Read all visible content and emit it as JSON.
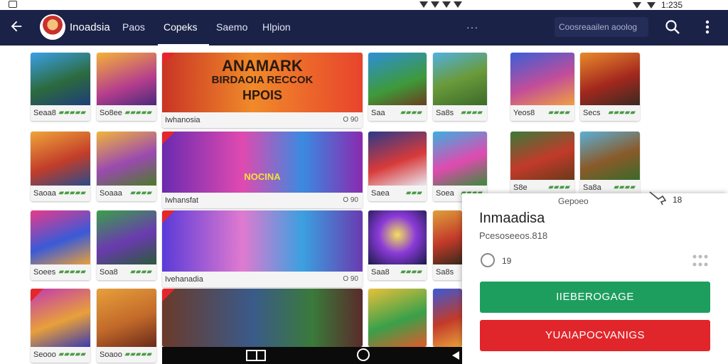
{
  "status_bar": {
    "time": "1:235"
  },
  "app_bar": {
    "brand": "Inoadsia",
    "tabs": [
      "Paos",
      "Copeks",
      "Saemo",
      "Hlpion"
    ],
    "active_tab": "Copeks",
    "overflow": "···",
    "search_placeholder": "Coosreaailen aoolog"
  },
  "tiles": [
    {
      "caption": "Seaa8",
      "rating": "▰▰▰▰▰"
    },
    {
      "caption": "So8ee",
      "rating": "▰▰▰▰▰"
    },
    {
      "caption": "Iwhanosia",
      "rating": "O 90"
    },
    {
      "caption": "Saa",
      "rating": "▰▰▰▰"
    },
    {
      "caption": "Sa8s",
      "rating": "▰▰▰▰"
    },
    {
      "caption": "Yeos8",
      "rating": "▰▰▰▰"
    },
    {
      "caption": "Secs",
      "rating": "▰▰▰▰▰"
    },
    {
      "caption": "Saoaa",
      "rating": "▰▰▰▰▰"
    },
    {
      "caption": "Soaaa",
      "rating": "▰▰▰▰"
    },
    {
      "caption": "Iwhansfat",
      "rating": "O 90"
    },
    {
      "caption": "Saea",
      "rating": "▰▰▰"
    },
    {
      "caption": "Soea",
      "rating": "▰▰▰▰"
    },
    {
      "caption": "S8e",
      "rating": "▰▰▰▰"
    },
    {
      "caption": "Sa8a",
      "rating": "▰▰▰▰"
    },
    {
      "caption": "Soees",
      "rating": "▰▰▰▰▰"
    },
    {
      "caption": "Soa8",
      "rating": "▰▰▰▰"
    },
    {
      "caption": "Ivehanadia",
      "rating": "O 90"
    },
    {
      "caption": "Saa8",
      "rating": "▰▰▰▰"
    },
    {
      "caption": "Sa8s",
      "rating": "▰▰▰▰"
    },
    {
      "caption": "Seooo",
      "rating": "▰▰▰▰▰"
    },
    {
      "caption": "Soaoo",
      "rating": "▰▰▰▰▰"
    },
    {
      "caption": "",
      "rating": ""
    },
    {
      "caption": "",
      "rating": ""
    }
  ],
  "banners": {
    "b1_line1": "ANAMARK",
    "b1_line2": "BIRDAOIA RECCOK",
    "b1_line3": "HPOIS",
    "b2_label": "NOCINA"
  },
  "sheet": {
    "top_label": "Gepoeo",
    "top_count": "18",
    "title": "Inmaadisa",
    "subtitle": "Pcesoseeos.818",
    "radio_label": "19",
    "primary_button": "IIEBEROGAGE",
    "secondary_button": "YUAIAPOCVANIGS"
  },
  "colors": {
    "app_bar": "#1a2247",
    "primary": "#1e9e5e",
    "danger": "#e1262b"
  }
}
